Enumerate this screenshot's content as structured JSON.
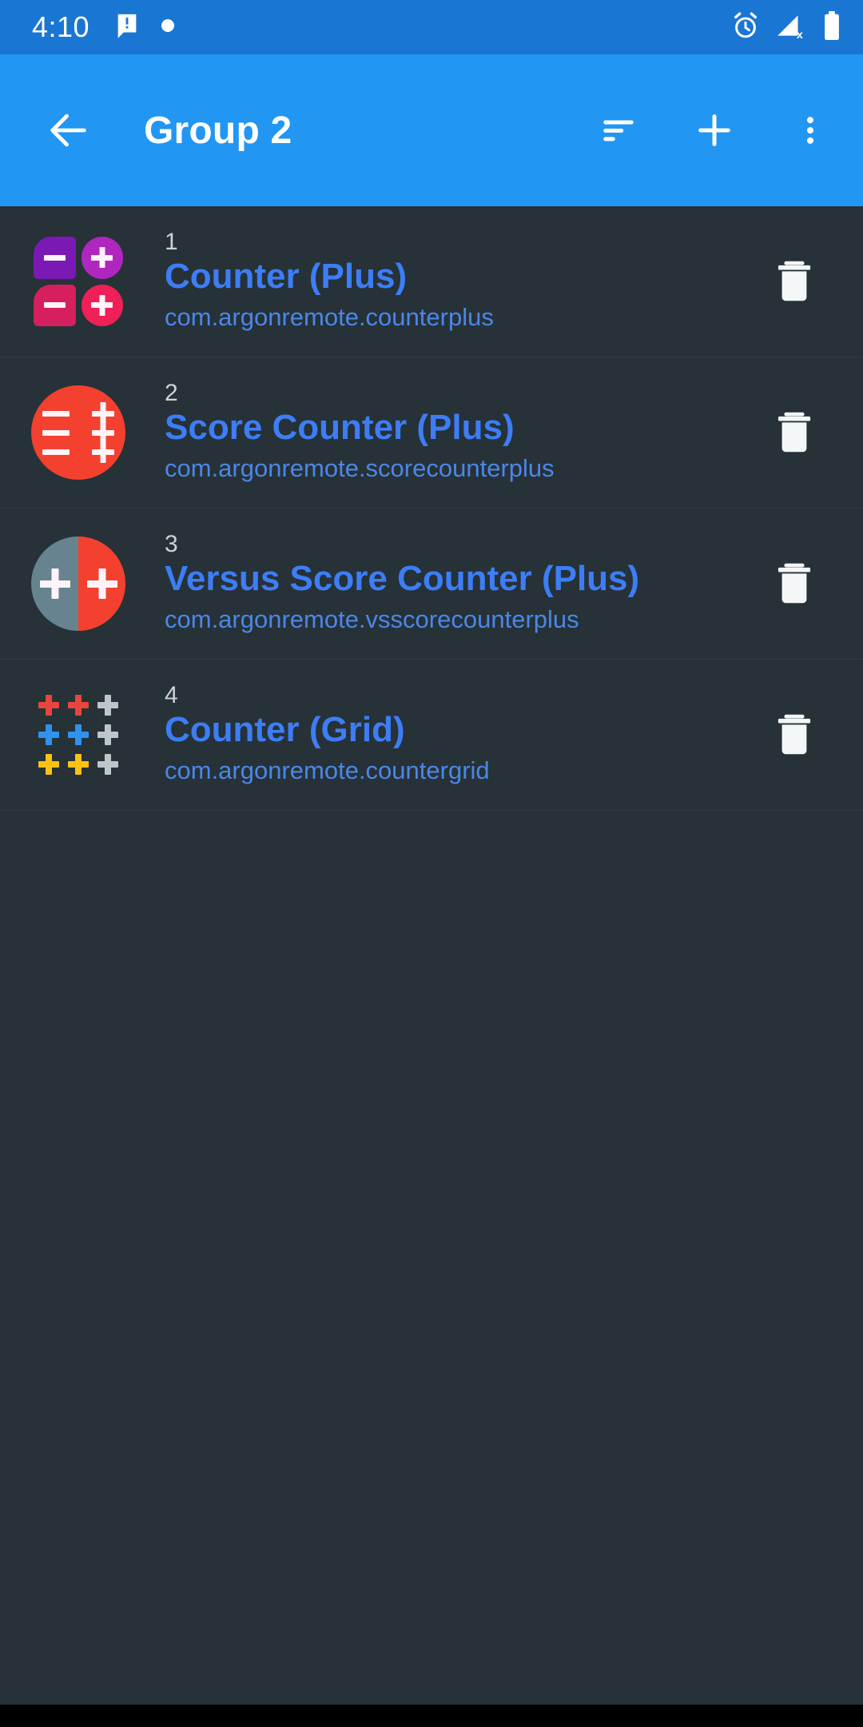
{
  "status_bar": {
    "time": "4:10",
    "left_icons": [
      "message-icon",
      "dot-icon"
    ],
    "right_icons": [
      "alarm-icon",
      "signal-off-icon",
      "battery-icon"
    ],
    "background_color": "#1976D2"
  },
  "app_bar": {
    "back_label": "back-arrow",
    "title": "Group 2",
    "actions": [
      {
        "name": "sort-button",
        "label": "sort"
      },
      {
        "name": "add-button",
        "label": "add"
      },
      {
        "name": "overflow-menu-button",
        "label": "more options"
      }
    ],
    "background_color": "#2196F3"
  },
  "list": {
    "delete_label": "Delete",
    "items": [
      {
        "index": "1",
        "title": "Counter (Plus)",
        "package": "com.argonremote.counterplus",
        "icon": "counter-plus-icon",
        "icon_type": "grid2",
        "icon_colors": [
          "#7B19B5",
          "#AF27BE",
          "#D61F5E",
          "#EF2057"
        ]
      },
      {
        "index": "2",
        "title": "Score Counter (Plus)",
        "package": "com.argonremote.scorecounterplus",
        "icon": "score-counter-plus-icon",
        "icon_type": "circle",
        "icon_colors": [
          "#F4402E"
        ]
      },
      {
        "index": "3",
        "title": "Versus Score Counter (Plus)",
        "package": "com.argonremote.vsscorecounterplus",
        "icon": "versus-score-counter-plus-icon",
        "icon_type": "split",
        "icon_colors": [
          "#67838F",
          "#F4402E"
        ]
      },
      {
        "index": "4",
        "title": "Counter (Grid)",
        "package": "com.argonremote.countergrid",
        "icon": "counter-grid-icon",
        "icon_type": "grid3",
        "icon_colors": [
          "#E8453C",
          "#E8453C",
          "#BFC6CA",
          "#2F92EE",
          "#2F92EE",
          "#BFC6CA",
          "#FDC116",
          "#FDC116",
          "#BFC6CA"
        ]
      }
    ]
  },
  "theme": {
    "background": "#263238",
    "title_color": "#3D7DF6",
    "package_color": "#4C86E8",
    "index_color": "#CCD2D6"
  }
}
